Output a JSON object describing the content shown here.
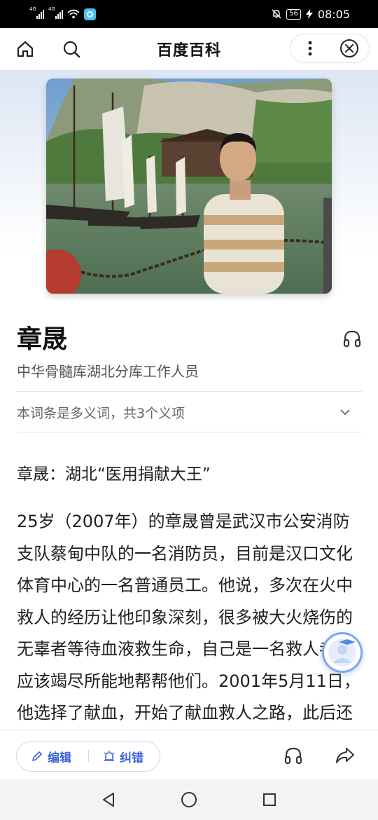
{
  "status_bar": {
    "signal1_tag": "4G",
    "signal2_tag": "4G",
    "battery": "56",
    "time": "08:05"
  },
  "header": {
    "title": "百度百科",
    "icons": [
      "home-icon",
      "search-icon",
      "more-icon",
      "close-icon"
    ]
  },
  "entry": {
    "title": "章晟",
    "subtitle": "中华骨髓库湖北分库工作人员",
    "polysemy": "本词条是多义词，共3个义项",
    "headline": "章晟：湖北“医用捐献大王”",
    "body": "25岁（2007年）的章晟曾是武汉市公安消防支队蔡甸中队的一名消防员，目前是汉口文化体育中心的一名普通员工。他说，多次在火中救人的经历让他印象深刻，很多被大火烧伤的无辜者等待血液救生命，自己是一名救人者，应该竭尽所能地帮帮他们。2001年5月11日，他选择了献血，开始了献血救人之路，此后还捐献造血干细胞和血小板。"
  },
  "toolbar": {
    "edit_label": "编辑",
    "fix_label": "纠错"
  },
  "colors": {
    "accent": "#3b66d6",
    "pill_border": "#c9d7f6",
    "status_bar": "#000000"
  }
}
